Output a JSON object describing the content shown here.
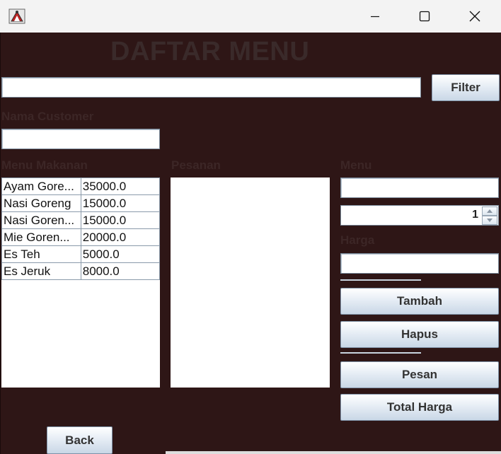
{
  "window": {
    "minimize_glyph": "—",
    "maximize_glyph": "☐",
    "close_glyph": "✕",
    "icon": "java-app-icon"
  },
  "heading": "DAFTAR MENU",
  "filter": {
    "value": "",
    "button_label": "Filter"
  },
  "customer": {
    "label": "Nama Customer",
    "value": ""
  },
  "menu_makanan": {
    "label": "Menu Makanan",
    "rows": [
      {
        "name": "Ayam Gore...",
        "price": "35000.0"
      },
      {
        "name": "Nasi Goreng",
        "price": "15000.0"
      },
      {
        "name": "Nasi Goren...",
        "price": "15000.0"
      },
      {
        "name": "Mie Goren...",
        "price": "20000.0"
      },
      {
        "name": "Es Teh",
        "price": "5000.0"
      },
      {
        "name": "Es Jeruk",
        "price": "8000.0"
      }
    ]
  },
  "pesanan": {
    "label": "Pesanan"
  },
  "side": {
    "menu_label": "Menu",
    "menu_value": "",
    "quantity": "1",
    "harga_label": "Harga",
    "harga_value": "",
    "tambah": "Tambah",
    "hapus": "Hapus",
    "pesan": "Pesan",
    "total": "Total Harga"
  },
  "back": "Back"
}
